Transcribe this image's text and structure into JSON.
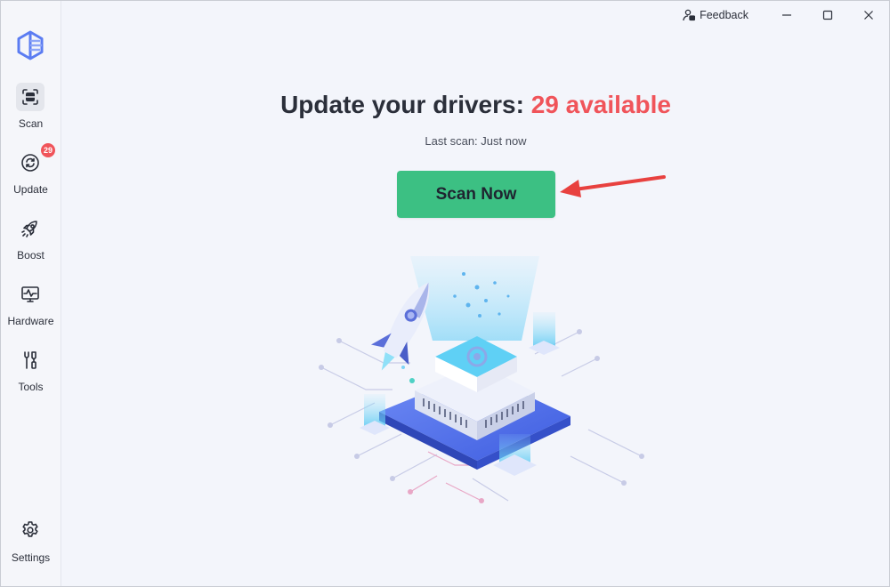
{
  "titlebar": {
    "feedback_label": "Feedback",
    "minimize_icon": "minimize-icon",
    "maximize_icon": "maximize-icon",
    "close_icon": "close-icon"
  },
  "sidebar": {
    "items": [
      {
        "label": "Scan",
        "icon": "scan-icon",
        "active": true
      },
      {
        "label": "Update",
        "icon": "refresh-icon",
        "badge": "29"
      },
      {
        "label": "Boost",
        "icon": "rocket-icon"
      },
      {
        "label": "Hardware",
        "icon": "monitor-icon"
      },
      {
        "label": "Tools",
        "icon": "tools-icon"
      }
    ],
    "settings_label": "Settings"
  },
  "main": {
    "headline_prefix": "Update your drivers: ",
    "headline_count": "29 available",
    "last_scan": "Last scan: Just now",
    "scan_button": "Scan Now"
  },
  "colors": {
    "accent_green": "#3cc083",
    "alert_red": "#f0545a",
    "brand_blue": "#5b7cf2"
  }
}
